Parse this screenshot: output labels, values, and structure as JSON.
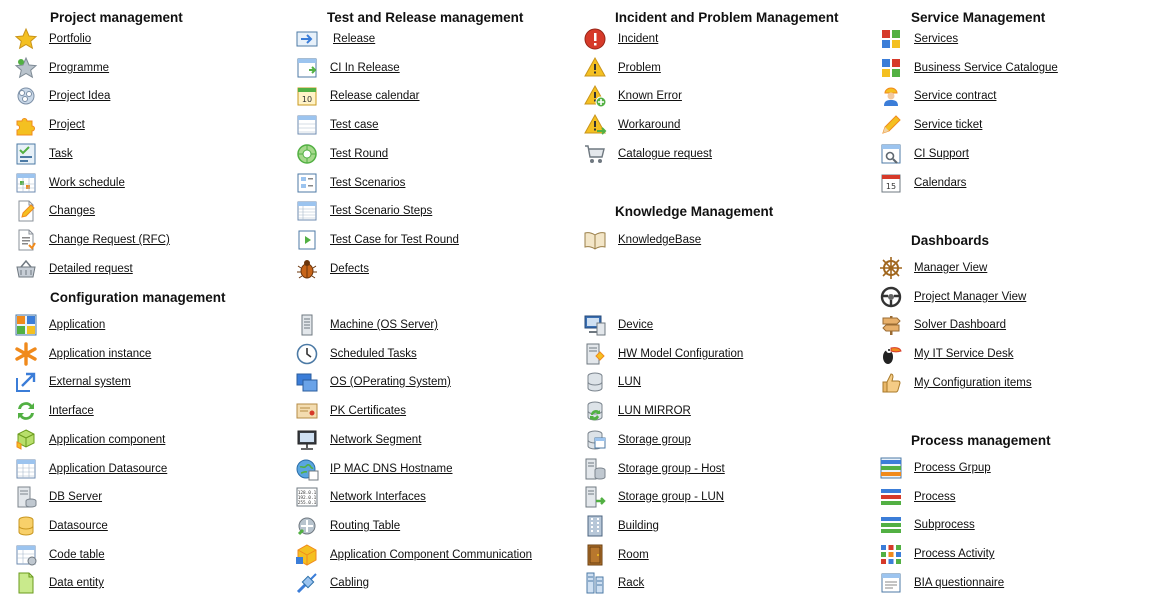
{
  "sections": {
    "project_management": {
      "title": "Project management",
      "items": [
        "Portfolio",
        "Programme",
        "Project Idea",
        "Project",
        "Task",
        "Work schedule",
        "Changes",
        "Change Request (RFC)",
        "Detailed request"
      ]
    },
    "test_release": {
      "title": "Test and Release management",
      "items": [
        "Release",
        "CI In Release",
        "Release calendar",
        "Test case",
        "Test Round",
        "Test Scenarios",
        "Test Scenario Steps",
        "Test Case for Test Round",
        "Defects"
      ]
    },
    "incident_problem": {
      "title": "Incident and Problem Management",
      "items": [
        "Incident",
        "Problem",
        "Known Error",
        "Workaround",
        "Catalogue request"
      ]
    },
    "service_management": {
      "title": "Service Management",
      "items": [
        "Services",
        "Business Service Catalogue",
        "Service contract",
        "Service ticket",
        "CI Support",
        "Calendars"
      ]
    },
    "knowledge_management": {
      "title": "Knowledge Management",
      "items": [
        "KnowledgeBase"
      ]
    },
    "dashboards": {
      "title": "Dashboards",
      "items": [
        "Manager View",
        "Project Manager View",
        "Solver Dashboard",
        "My IT Service Desk",
        "My Configuration items"
      ]
    },
    "configuration_management": {
      "title": "Configuration management",
      "col1": [
        "Application",
        "Application instance",
        "External system",
        "Interface",
        "Application component",
        "Application Datasource",
        "DB Server",
        "Datasource",
        "Code table",
        "Data entity"
      ],
      "col2": [
        "Machine (OS Server)",
        "Scheduled Tasks",
        "OS (OPerating System)",
        "PK Certificates",
        "Network Segment",
        "IP MAC DNS Hostname",
        "Network Interfaces",
        "Routing Table",
        "Application Component Communication",
        "Cabling"
      ],
      "col3": [
        "Device",
        "HW Model Configuration",
        "LUN",
        "LUN MIRROR",
        "Storage group",
        "Storage group - Host",
        "Storage group - LUN",
        "Building",
        "Room",
        "Rack"
      ]
    },
    "process_management": {
      "title": "Process management",
      "items": [
        "Process Grpup",
        "Process",
        "Subprocess",
        "Process Activity",
        "BIA questionnaire"
      ]
    }
  },
  "icons": {
    "project_management": [
      "star-gold-icon",
      "star-gray-icon",
      "cog-cloud-icon",
      "puzzle-icon",
      "task-board-icon",
      "schedule-grid-icon",
      "pencil-doc-icon",
      "request-doc-icon",
      "basket-icon"
    ],
    "test_release": [
      "release-arrow-icon",
      "ci-window-icon",
      "calendar-10-icon",
      "test-sheet-icon",
      "test-round-icon",
      "scenarios-icon",
      "scenario-steps-icon",
      "play-doc-icon",
      "bug-icon"
    ],
    "incident_problem": [
      "error-red-icon",
      "warning-icon",
      "warning-plus-icon",
      "warning-arrow-icon",
      "cart-icon"
    ],
    "service_management": [
      "services-grid-icon",
      "catalogue-grid-icon",
      "worker-icon",
      "pencil-icon",
      "ci-support-icon",
      "calendar-15-icon"
    ],
    "knowledge_management": [
      "book-icon"
    ],
    "dashboards": [
      "ship-wheel-icon",
      "steering-wheel-icon",
      "signpost-icon",
      "toucan-icon",
      "thumbs-up-icon"
    ],
    "config_col1": [
      "app-grid-icon",
      "asterisk-icon",
      "external-arrow-icon",
      "interface-arrows-icon",
      "cubes-icon",
      "datasource-table-icon",
      "db-server-icon",
      "database-icon",
      "code-table-icon",
      "data-entity-icon"
    ],
    "config_col2": [
      "server-tower-icon",
      "clock-icon",
      "windows-icon",
      "certificate-icon",
      "network-monitor-icon",
      "globe-icon",
      "ip-list-icon",
      "routing-icon",
      "component-cube-icon",
      "cable-icon"
    ],
    "config_col3": [
      "device-icon",
      "hw-model-icon",
      "lun-disk-icon",
      "lun-mirror-icon",
      "storage-group-icon",
      "storage-host-icon",
      "storage-lun-icon",
      "building-icon",
      "door-icon",
      "rack-icon"
    ],
    "process_management": [
      "process-group-icon",
      "process-icon",
      "subprocess-icon",
      "process-activity-icon",
      "questionnaire-icon"
    ]
  },
  "colors": {
    "text": "#111111",
    "background": "#ffffff",
    "warning_yellow": "#f6c500",
    "error_red": "#d63a2a",
    "accent_blue": "#3b7dd8",
    "green": "#4caf50"
  }
}
